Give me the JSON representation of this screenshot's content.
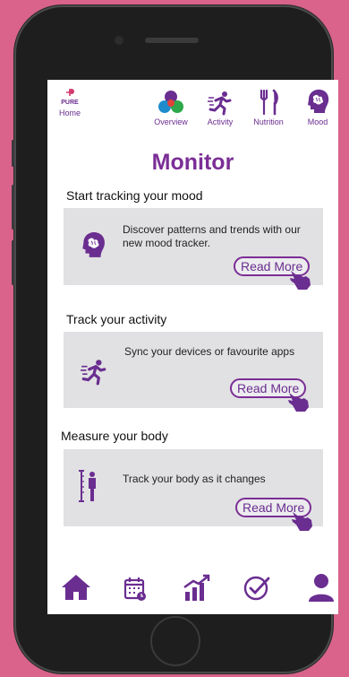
{
  "app": {
    "brand_logo_text": "PURE"
  },
  "nav": {
    "home_label": "Home",
    "items": [
      {
        "label": "Overview",
        "icon": "overview-icon"
      },
      {
        "label": "Activity",
        "icon": "running-icon"
      },
      {
        "label": "Nutrition",
        "icon": "fork-knife-icon"
      },
      {
        "label": "Mood",
        "icon": "brain-head-icon"
      }
    ]
  },
  "page": {
    "title": "Monitor"
  },
  "sections": [
    {
      "heading": "Start tracking your mood",
      "text": "Discover patterns and trends with our new mood tracker.",
      "button": "Read More",
      "icon": "brain-head-icon"
    },
    {
      "heading": "Track your activity",
      "text": "Sync your devices or favourite apps",
      "button": "Read More",
      "icon": "running-icon"
    },
    {
      "heading": "Measure your body",
      "text": "Track your body as it changes",
      "button": "Read More",
      "icon": "height-measure-icon"
    }
  ],
  "tabbar": {
    "items": [
      "home-icon",
      "calendar-icon",
      "chart-icon",
      "check-icon",
      "profile-icon"
    ]
  },
  "colors": {
    "accent": "#7b2e96",
    "background": "#d9638a",
    "card": "#e1e1e3"
  }
}
